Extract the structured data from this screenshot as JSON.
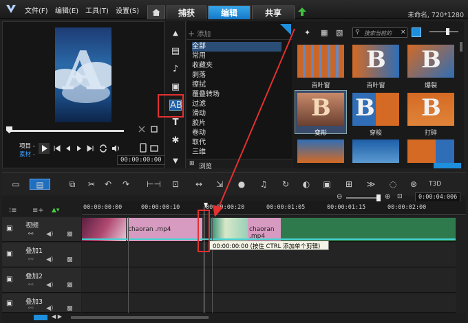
{
  "menu": [
    "文件(F)",
    "编辑(E)",
    "工具(T)",
    "设置(S)"
  ],
  "tabs": {
    "capture": "捕获",
    "edit": "编辑",
    "share": "共享"
  },
  "project_info": "未命名, 720*1280",
  "preview": {
    "letter": "A",
    "project_label": "项目 -",
    "clip_label": "素材 -",
    "timecode": "00:00:00:00"
  },
  "library": {
    "add_label": "添加",
    "categories": [
      "全部",
      "常用",
      "收藏夹",
      "剥落",
      "擦拭",
      "覆叠转场",
      "过滤",
      "滑动",
      "胶片",
      "卷动",
      "取代",
      "三维"
    ],
    "browse_label": "浏览",
    "search_placeholder": "搜索当前的",
    "thumbnails": [
      {
        "label": "百叶窗"
      },
      {
        "label": "百叶窗"
      },
      {
        "label": "爆裂"
      },
      {
        "label": "变形"
      },
      {
        "label": "穿梭"
      },
      {
        "label": "打碎"
      },
      {
        "label": ""
      },
      {
        "label": ""
      },
      {
        "label": ""
      }
    ]
  },
  "timeline": {
    "ruler": [
      "00:00:00:00",
      "00:00:00:10",
      "00:00:00:20",
      "00:00:01:05",
      "00:00:01:15",
      "00:00:02:00"
    ],
    "zoom_timecode": "0:00:04:006",
    "tracks": [
      {
        "name": "视频"
      },
      {
        "name": "叠加1"
      },
      {
        "name": "叠加2"
      },
      {
        "name": "叠加3"
      }
    ],
    "clip_a_name": "chaoran .mp4",
    "clip_b_name": "chaoran .mp4",
    "tooltip": "00:00:00:00   (按住 CTRL 添加单个剪辑)"
  },
  "colors": {
    "accent_tab": "#1e8fdc",
    "annotation": "#e53030",
    "clip_pink": "#d79ac0",
    "clip_green": "#2e7a4d"
  }
}
